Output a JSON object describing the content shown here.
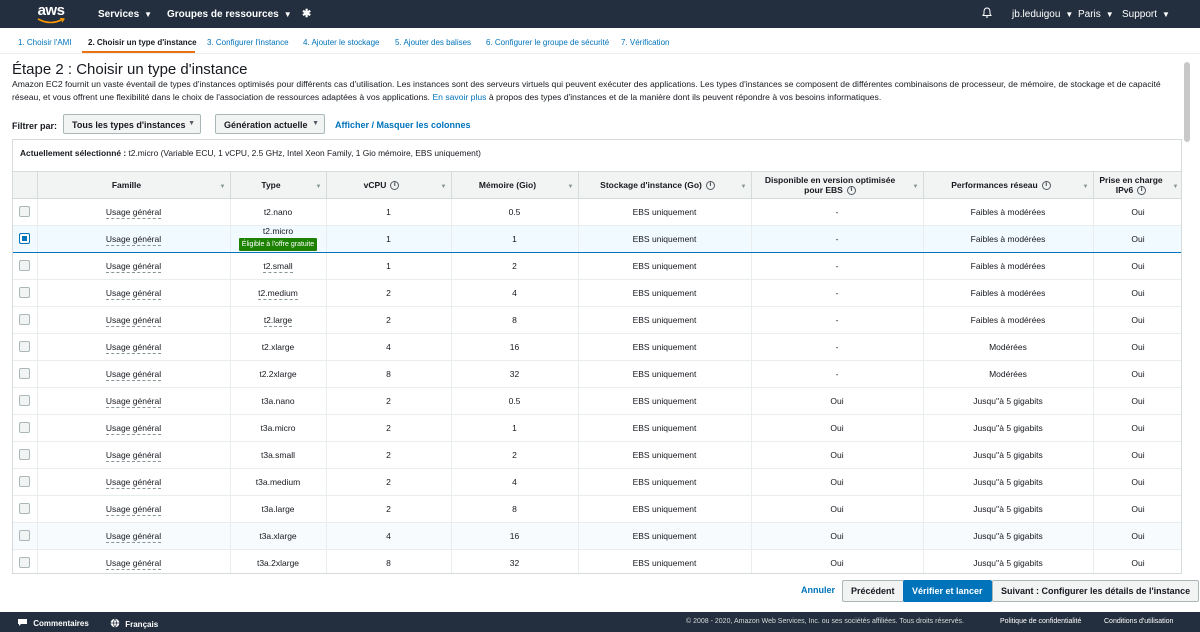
{
  "topnav": {
    "logo": "aws",
    "services": "Services",
    "resource_groups": "Groupes de ressources",
    "user": "jb.leduigou",
    "region": "Paris",
    "support": "Support"
  },
  "wizard": {
    "steps": [
      "1. Choisir l'AMI",
      "2. Choisir un type d'instance",
      "3. Configurer l'instance",
      "4. Ajouter le stockage",
      "5. Ajouter des balises",
      "6. Configurer le groupe de sécurité",
      "7. Vérification"
    ],
    "active_step": 2
  },
  "page": {
    "title": "Étape 2 : Choisir un type d'instance",
    "description": "Amazon EC2 fournit un vaste éventail de types d'instances optimisés pour différents cas d'utilisation. Les instances sont des serveurs virtuels qui peuvent exécuter des applications. Les types d'instances se composent de différentes combinaisons de processeur, de mémoire, de stockage et de capacité réseau, et vous offrent une flexibilité dans le choix de l'association de ressources adaptées à vos applications.",
    "learn_more": "En savoir plus",
    "description_end": "à propos des types d'instances et de la manière dont ils peuvent répondre à vos besoins informatiques."
  },
  "filters": {
    "label": "Filtrer par:",
    "all_types": "Tous les types d'instances",
    "generation": "Génération actuelle",
    "toggle_columns": "Afficher / Masquer les colonnes"
  },
  "current_selection": {
    "label": "Actuellement sélectionné :",
    "value": "t2.micro (Variable ECU, 1 vCPU, 2.5 GHz, Intel Xeon Family, 1 Gio mémoire, EBS uniquement)"
  },
  "table": {
    "headers": {
      "family": "Famille",
      "type": "Type",
      "vcpu": "vCPU",
      "memory": "Mémoire (Gio)",
      "storage": "Stockage d'instance (Go)",
      "ebs_optimized": "Disponible en version optimisée pour EBS",
      "network": "Performances réseau",
      "ipv6": "Prise en charge IPv6"
    },
    "free_tier_badge": "Éligible à l'offre gratuite",
    "rows": [
      {
        "family": "Usage général",
        "type": "t2.nano",
        "vcpu": "1",
        "memory": "0.5",
        "storage": "EBS uniquement",
        "ebs": "-",
        "network": "Faibles à modérées",
        "ipv6": "Oui"
      },
      {
        "family": "Usage général",
        "type": "t2.micro",
        "vcpu": "1",
        "memory": "1",
        "storage": "EBS uniquement",
        "ebs": "-",
        "network": "Faibles à modérées",
        "ipv6": "Oui"
      },
      {
        "family": "Usage général",
        "type": "t2.small",
        "vcpu": "1",
        "memory": "2",
        "storage": "EBS uniquement",
        "ebs": "-",
        "network": "Faibles à modérées",
        "ipv6": "Oui"
      },
      {
        "family": "Usage général",
        "type": "t2.medium",
        "vcpu": "2",
        "memory": "4",
        "storage": "EBS uniquement",
        "ebs": "-",
        "network": "Faibles à modérées",
        "ipv6": "Oui"
      },
      {
        "family": "Usage général",
        "type": "t2.large",
        "vcpu": "2",
        "memory": "8",
        "storage": "EBS uniquement",
        "ebs": "-",
        "network": "Faibles à modérées",
        "ipv6": "Oui"
      },
      {
        "family": "Usage général",
        "type": "t2.xlarge",
        "vcpu": "4",
        "memory": "16",
        "storage": "EBS uniquement",
        "ebs": "-",
        "network": "Modérées",
        "ipv6": "Oui"
      },
      {
        "family": "Usage général",
        "type": "t2.2xlarge",
        "vcpu": "8",
        "memory": "32",
        "storage": "EBS uniquement",
        "ebs": "-",
        "network": "Modérées",
        "ipv6": "Oui"
      },
      {
        "family": "Usage général",
        "type": "t3a.nano",
        "vcpu": "2",
        "memory": "0.5",
        "storage": "EBS uniquement",
        "ebs": "Oui",
        "network": "Jusqu''à 5 gigabits",
        "ipv6": "Oui"
      },
      {
        "family": "Usage général",
        "type": "t3a.micro",
        "vcpu": "2",
        "memory": "1",
        "storage": "EBS uniquement",
        "ebs": "Oui",
        "network": "Jusqu''à 5 gigabits",
        "ipv6": "Oui"
      },
      {
        "family": "Usage général",
        "type": "t3a.small",
        "vcpu": "2",
        "memory": "2",
        "storage": "EBS uniquement",
        "ebs": "Oui",
        "network": "Jusqu''à 5 gigabits",
        "ipv6": "Oui"
      },
      {
        "family": "Usage général",
        "type": "t3a.medium",
        "vcpu": "2",
        "memory": "4",
        "storage": "EBS uniquement",
        "ebs": "Oui",
        "network": "Jusqu''à 5 gigabits",
        "ipv6": "Oui"
      },
      {
        "family": "Usage général",
        "type": "t3a.large",
        "vcpu": "2",
        "memory": "8",
        "storage": "EBS uniquement",
        "ebs": "Oui",
        "network": "Jusqu''à 5 gigabits",
        "ipv6": "Oui"
      },
      {
        "family": "Usage général",
        "type": "t3a.xlarge",
        "vcpu": "4",
        "memory": "16",
        "storage": "EBS uniquement",
        "ebs": "Oui",
        "network": "Jusqu''à 5 gigabits",
        "ipv6": "Oui"
      },
      {
        "family": "Usage général",
        "type": "t3a.2xlarge",
        "vcpu": "8",
        "memory": "32",
        "storage": "EBS uniquement",
        "ebs": "Oui",
        "network": "Jusqu''à 5 gigabits",
        "ipv6": "Oui"
      }
    ]
  },
  "actions": {
    "cancel": "Annuler",
    "previous": "Précédent",
    "review_launch": "Vérifier et lancer",
    "next": "Suivant : Configurer les détails de l'instance"
  },
  "footer": {
    "feedback": "Commentaires",
    "language": "Français",
    "copyright": "© 2008 - 2020, Amazon Web Services, Inc. ou ses sociétés affiliées. Tous droits réservés.",
    "privacy": "Politique de confidentialité",
    "terms": "Conditions d'utilisation"
  }
}
